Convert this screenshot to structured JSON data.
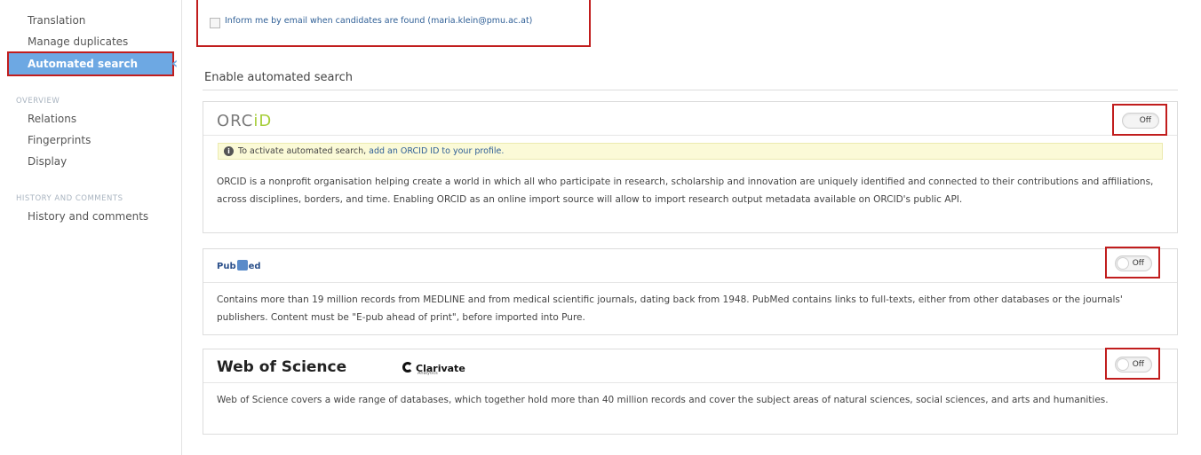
{
  "sidebar": {
    "items_top": [
      "Translation",
      "Manage duplicates"
    ],
    "active": "Automated search",
    "overview_heading": "OVERVIEW",
    "overview_items": [
      "Relations",
      "Fingerprints",
      "Display"
    ],
    "history_heading": "HISTORY AND COMMENTS",
    "history_items": [
      "History and comments"
    ]
  },
  "email_notify": {
    "label": "Inform me by email when candidates are found (maria.klein@pmu.ac.at)",
    "checked": false
  },
  "section": {
    "title": "Enable automated search"
  },
  "sources": {
    "orcid": {
      "logo_text_a": "ORC",
      "logo_text_b": "iD",
      "notice_text": "To activate automated search,",
      "notice_link": "add an ORCID ID to your profile.",
      "description": "ORCID is a nonprofit organisation helping create a world in which all who participate in research, scholarship and innovation are uniquely identified and connected to their contributions and affiliations, across disciplines, borders, and time. Enabling ORCID as an online import source will allow to import research output metadata available on ORCID's public API.",
      "toggle": "Off"
    },
    "pubmed": {
      "logo_a": "Pub",
      "logo_b": "ed",
      "description": "Contains more than 19 million records from MEDLINE and from medical scientific journals, dating back from 1948. PubMed contains links to full-texts, either from other databases or the journals' publishers. Content must be \"E-pub ahead of print\", before imported into Pure.",
      "toggle": "Off"
    },
    "wos": {
      "title": "Web of Science",
      "partner": "Clarivate",
      "partner_sub": "Analytics",
      "description": "Web of Science covers a wide range of databases, which together hold more than 40 million records and cover the subject areas of natural sciences, social sciences, and arts and humanities.",
      "toggle": "Off"
    }
  },
  "colors": {
    "highlight_border": "#c11d1d",
    "sidebar_active": "#6da8e3",
    "link": "#2f5f96",
    "orcid_green": "#a6ce39"
  }
}
